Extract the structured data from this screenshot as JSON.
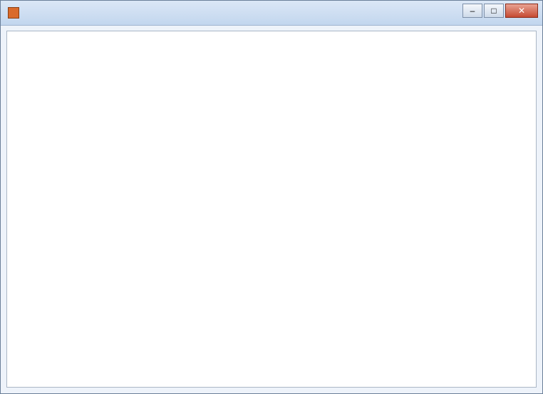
{
  "window": {
    "title": "",
    "minimize_glyph": "–",
    "maximize_glyph": "□",
    "close_glyph": "✕"
  },
  "main": {
    "placeholder_text": ""
  }
}
